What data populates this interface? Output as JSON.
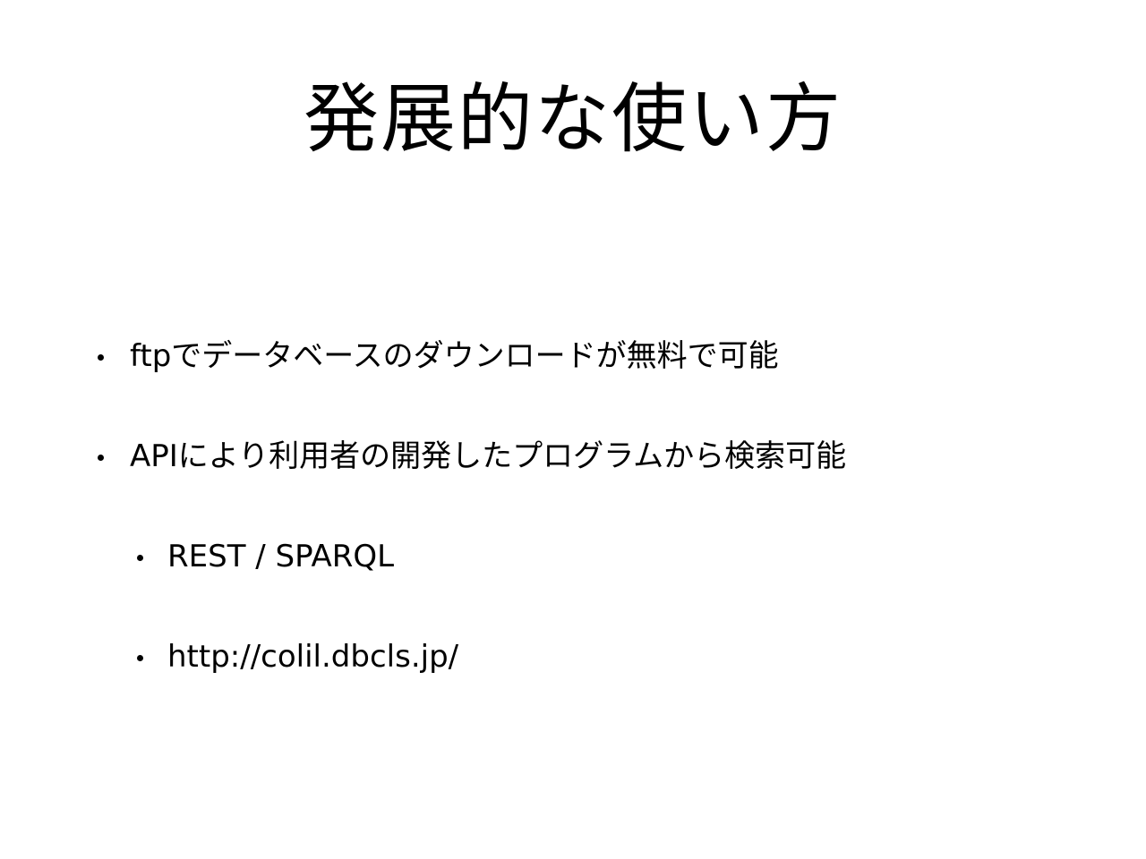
{
  "slide": {
    "title": "発展的な使い方",
    "bullets": [
      {
        "text": "ftpでデータベースのダウンロードが無料で可能",
        "level": 1
      },
      {
        "text": "APIにより利用者の開発したプログラムから検索可能",
        "level": 1
      },
      {
        "text": "REST / SPARQL",
        "level": 2
      },
      {
        "text": "http://colil.dbcls.jp/",
        "level": 2
      }
    ]
  }
}
